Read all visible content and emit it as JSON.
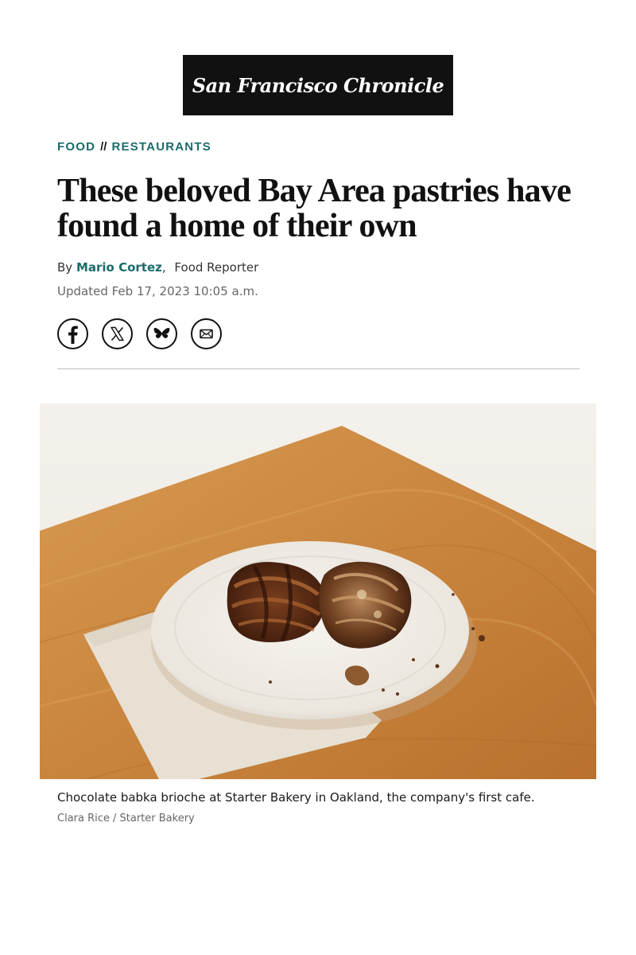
{
  "masthead": {
    "logo_text": "San Francisco Chronicle"
  },
  "section": {
    "primary": "FOOD",
    "separator": "//",
    "secondary": "RESTAURANTS"
  },
  "article": {
    "headline": "These beloved Bay Area pastries have found a home of their own",
    "byline_prefix": "By",
    "author": "Mario Cortez",
    "author_separator": ",",
    "author_role": "Food Reporter",
    "updated": "Updated Feb 17, 2023 10:05 a.m."
  },
  "share": {
    "icons": [
      "facebook-icon",
      "x-icon",
      "bluesky-icon",
      "email-icon"
    ]
  },
  "photo": {
    "caption": "Chocolate babka brioche at Starter Bakery in Oakland, the company's first cafe.",
    "credit": "Clara Rice / Starter Bakery"
  },
  "colors": {
    "accent": "#1c6b6b",
    "masthead_bg": "#111111"
  }
}
